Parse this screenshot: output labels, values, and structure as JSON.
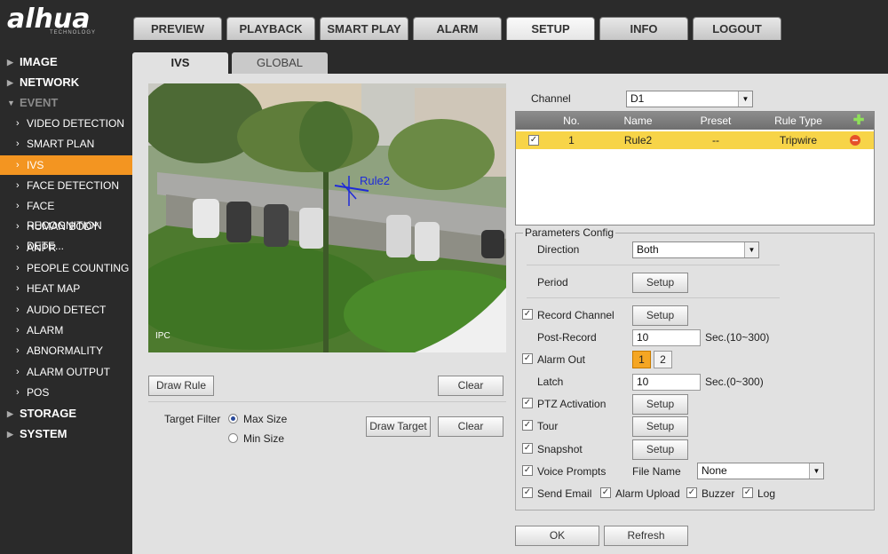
{
  "brand": {
    "logo": "alhua",
    "tagline": "TECHNOLOGY"
  },
  "top_tabs": [
    "PREVIEW",
    "PLAYBACK",
    "SMART PLAY",
    "ALARM",
    "SETUP",
    "INFO",
    "LOGOUT"
  ],
  "active_top_tab": "SETUP",
  "sidebar": {
    "items": [
      {
        "label": "IMAGE",
        "level": "top"
      },
      {
        "label": "NETWORK",
        "level": "top"
      },
      {
        "label": "EVENT",
        "level": "top"
      },
      {
        "label": "VIDEO DETECTION",
        "level": "sub"
      },
      {
        "label": "SMART PLAN",
        "level": "sub"
      },
      {
        "label": "IVS",
        "level": "sub"
      },
      {
        "label": "FACE DETECTION",
        "level": "sub"
      },
      {
        "label": "FACE RECOGNITION",
        "level": "sub"
      },
      {
        "label": "HUMAN BODY DETE...",
        "level": "sub"
      },
      {
        "label": "ANPR",
        "level": "sub"
      },
      {
        "label": "PEOPLE COUNTING",
        "level": "sub"
      },
      {
        "label": "HEAT MAP",
        "level": "sub"
      },
      {
        "label": "AUDIO DETECT",
        "level": "sub"
      },
      {
        "label": "ALARM",
        "level": "sub"
      },
      {
        "label": "ABNORMALITY",
        "level": "sub"
      },
      {
        "label": "ALARM OUTPUT",
        "level": "sub"
      },
      {
        "label": "POS",
        "level": "sub"
      },
      {
        "label": "STORAGE",
        "level": "top"
      },
      {
        "label": "SYSTEM",
        "level": "top"
      }
    ],
    "active": "IVS"
  },
  "sub_tabs": {
    "active": "IVS",
    "other": "GLOBAL"
  },
  "video": {
    "rule_label": "Rule2",
    "watermark": "IPC"
  },
  "left_controls": {
    "draw_rule": "Draw Rule",
    "clear1": "Clear",
    "target_filter_label": "Target Filter",
    "max_size": "Max Size",
    "min_size": "Min Size",
    "draw_target": "Draw Target",
    "clear2": "Clear"
  },
  "channel": {
    "label": "Channel",
    "value": "D1"
  },
  "rule_table": {
    "headers": [
      "No.",
      "Name",
      "Preset",
      "Rule Type"
    ],
    "rows": [
      {
        "checked": true,
        "no": "1",
        "name": "Rule2",
        "preset": "--",
        "type": "Tripwire"
      }
    ]
  },
  "params": {
    "title": "Parameters Config",
    "direction_label": "Direction",
    "direction_value": "Both",
    "period_label": "Period",
    "setup": "Setup",
    "record_channel": "Record Channel",
    "post_record_label": "Post-Record",
    "post_record_value": "10",
    "post_record_unit": "Sec.(10~300)",
    "alarm_out": "Alarm Out",
    "alarm_out_1": "1",
    "alarm_out_2": "2",
    "latch_label": "Latch",
    "latch_value": "10",
    "latch_unit": "Sec.(0~300)",
    "ptz": "PTZ Activation",
    "tour": "Tour",
    "snapshot": "Snapshot",
    "voice": "Voice Prompts",
    "file_name_label": "File Name",
    "file_name_value": "None",
    "send_email": "Send Email",
    "alarm_upload": "Alarm Upload",
    "buzzer": "Buzzer",
    "log": "Log"
  },
  "footer": {
    "ok": "OK",
    "refresh": "Refresh"
  },
  "colors": {
    "accent": "#f39521",
    "row_highlight": "#f7d448"
  }
}
